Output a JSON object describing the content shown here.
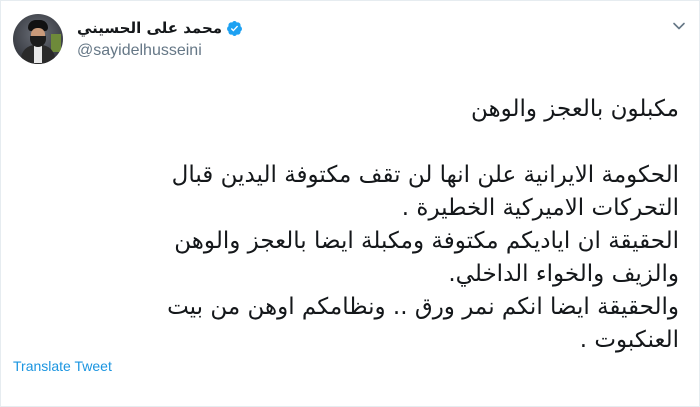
{
  "tweet": {
    "author": {
      "display_name": "محمد على الحسيني",
      "handle": "@sayidelhusseini",
      "verified": true,
      "verified_icon": "verified-badge-icon",
      "avatar_icon": "profile-photo"
    },
    "menu_icon": "chevron-down-icon",
    "lines": [
      "مكبلون بالعجز والوهن",
      "",
      "الحكومة الايرانية علن انها لن تقف مكتوفة اليدين قبال",
      "التحركات الاميركية الخطيرة .",
      "الحقيقة ان اياديكم مكتوفة ومكبلة ايضا بالعجز والوهن",
      "والزيف والخواء الداخلي.",
      "والحقيقة ايضا انكم نمر ورق .. ونظامكم اوهن من بيت",
      "العنكبوت ."
    ],
    "translate_label": "Translate Tweet"
  },
  "colors": {
    "text": "#14171a",
    "secondary": "#657786",
    "link": "#1b95e0",
    "verified": "#1da1f2"
  }
}
